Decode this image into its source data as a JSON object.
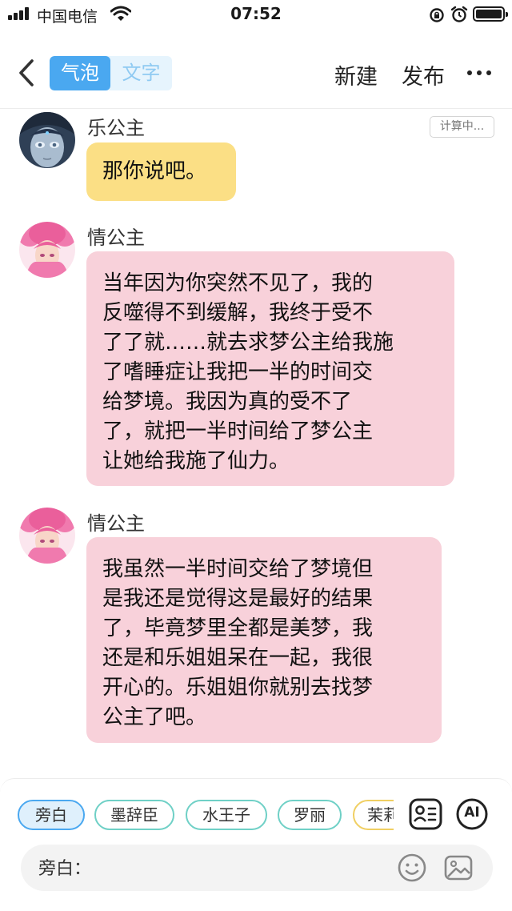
{
  "status_bar": {
    "carrier": "中国电信",
    "time": "07:52"
  },
  "nav": {
    "toggle_bubble": "气泡",
    "toggle_text": "文字",
    "new_label": "新建",
    "publish_label": "发布"
  },
  "chat": {
    "calc_tag": "计算中...",
    "messages": [
      {
        "sender": "乐公主",
        "text": "那你说吧。",
        "bubble_color": "#fbdf85"
      },
      {
        "sender": "情公主",
        "text": "当年因为你突然不见了，我的\n反噬得不到缓解，我终于受不\n了了就……就去求梦公主给我施\n了嗜睡症让我把一半的时间交\n给梦境。我因为真的受不了\n了，就把一半时间给了梦公主\n让她给我施了仙力。",
        "bubble_color": "#f8d1da"
      },
      {
        "sender": "情公主",
        "text": "我虽然一半时间交给了梦境但\n是我还是觉得这是最好的结果\n了，毕竟梦里全都是美梦，我\n还是和乐姐姐呆在一起，我很\n开心的。乐姐姐你就别去找梦\n公主了吧。",
        "bubble_color": "#f8d1da"
      }
    ]
  },
  "bottom": {
    "chips": [
      "旁白",
      "墨辞臣",
      "水王子",
      "罗丽",
      "茉莉"
    ],
    "ai_label": "AI",
    "input_label": "旁白："
  },
  "colors": {
    "accent_blue": "#4aa8f0",
    "chip_border": "#6fd0c6",
    "yellow_bubble": "#fbdf85",
    "pink_bubble": "#f8d1da"
  },
  "icons": [
    "signal-icon",
    "wifi-icon",
    "orientation-lock-icon",
    "alarm-icon",
    "battery-icon",
    "back-chevron-icon",
    "more-icon",
    "character-card-icon",
    "ai-icon",
    "emoji-icon",
    "image-icon"
  ]
}
